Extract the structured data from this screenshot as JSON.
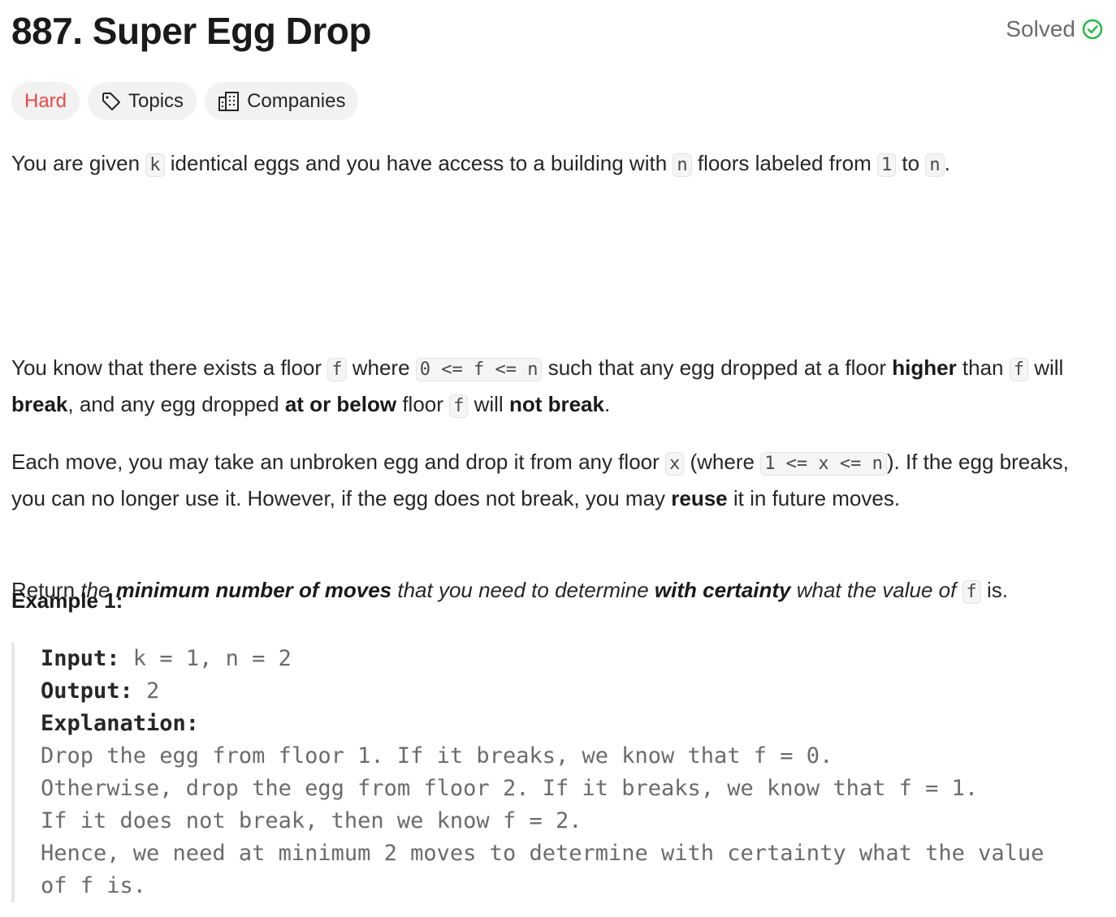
{
  "problem": {
    "title": "887. Super Egg Drop",
    "status": "Solved"
  },
  "tags": {
    "difficulty": "Hard",
    "topics": "Topics",
    "companies": "Companies"
  },
  "colors": {
    "difficulty_hard": "#ef4743",
    "solved_check": "#1fb843",
    "text": "#262626"
  },
  "description": {
    "p1": {
      "t1": "You are given ",
      "c1": "k",
      "t2": " identical eggs and you have access to a building with ",
      "c2": "n",
      "t3": " floors labeled from ",
      "c3": "1",
      "t4": " to ",
      "c4": "n",
      "t5": "."
    },
    "p2": {
      "t1": "You know that there exists a floor ",
      "c1": "f",
      "t2": " where ",
      "c2": "0 <= f <= n",
      "t3": " such that any egg dropped at a floor ",
      "b1": "higher",
      "t4": " than ",
      "c3": "f",
      "t5": " will ",
      "b2": "break",
      "t6": ", and any egg dropped ",
      "b3": "at or below",
      "t7": " floor ",
      "c4": "f",
      "t8": " will ",
      "b4": "not break",
      "t9": "."
    },
    "p3": {
      "t1": "Each move, you may take an unbroken egg and drop it from any floor ",
      "c1": "x",
      "t2": " (where ",
      "c2": "1 <= x <= n",
      "t3": "). If the egg breaks, you can no longer use it. However, if the egg does not break, you may ",
      "b1": "reuse",
      "t4": " it in future moves."
    },
    "p4": {
      "t1": "Return ",
      "i1": "the ",
      "bi1": "minimum number of moves",
      "i2": " that you need to determine ",
      "bi2": "with certainty",
      "i3": " what the value of ",
      "c1": "f",
      "t2": " is."
    }
  },
  "example1": {
    "title": "Example 1:",
    "input_label": "Input:",
    "input_value": " k = 1, n = 2",
    "output_label": "Output:",
    "output_value": " 2",
    "explanation_label": "Explanation:",
    "lines": [
      "Drop the egg from floor 1. If it breaks, we know that f = 0.",
      "Otherwise, drop the egg from floor 2. If it breaks, we know that f = 1.",
      "If it does not break, then we know f = 2.",
      "Hence, we need at minimum 2 moves to determine with certainty what the value",
      "of f is."
    ]
  }
}
